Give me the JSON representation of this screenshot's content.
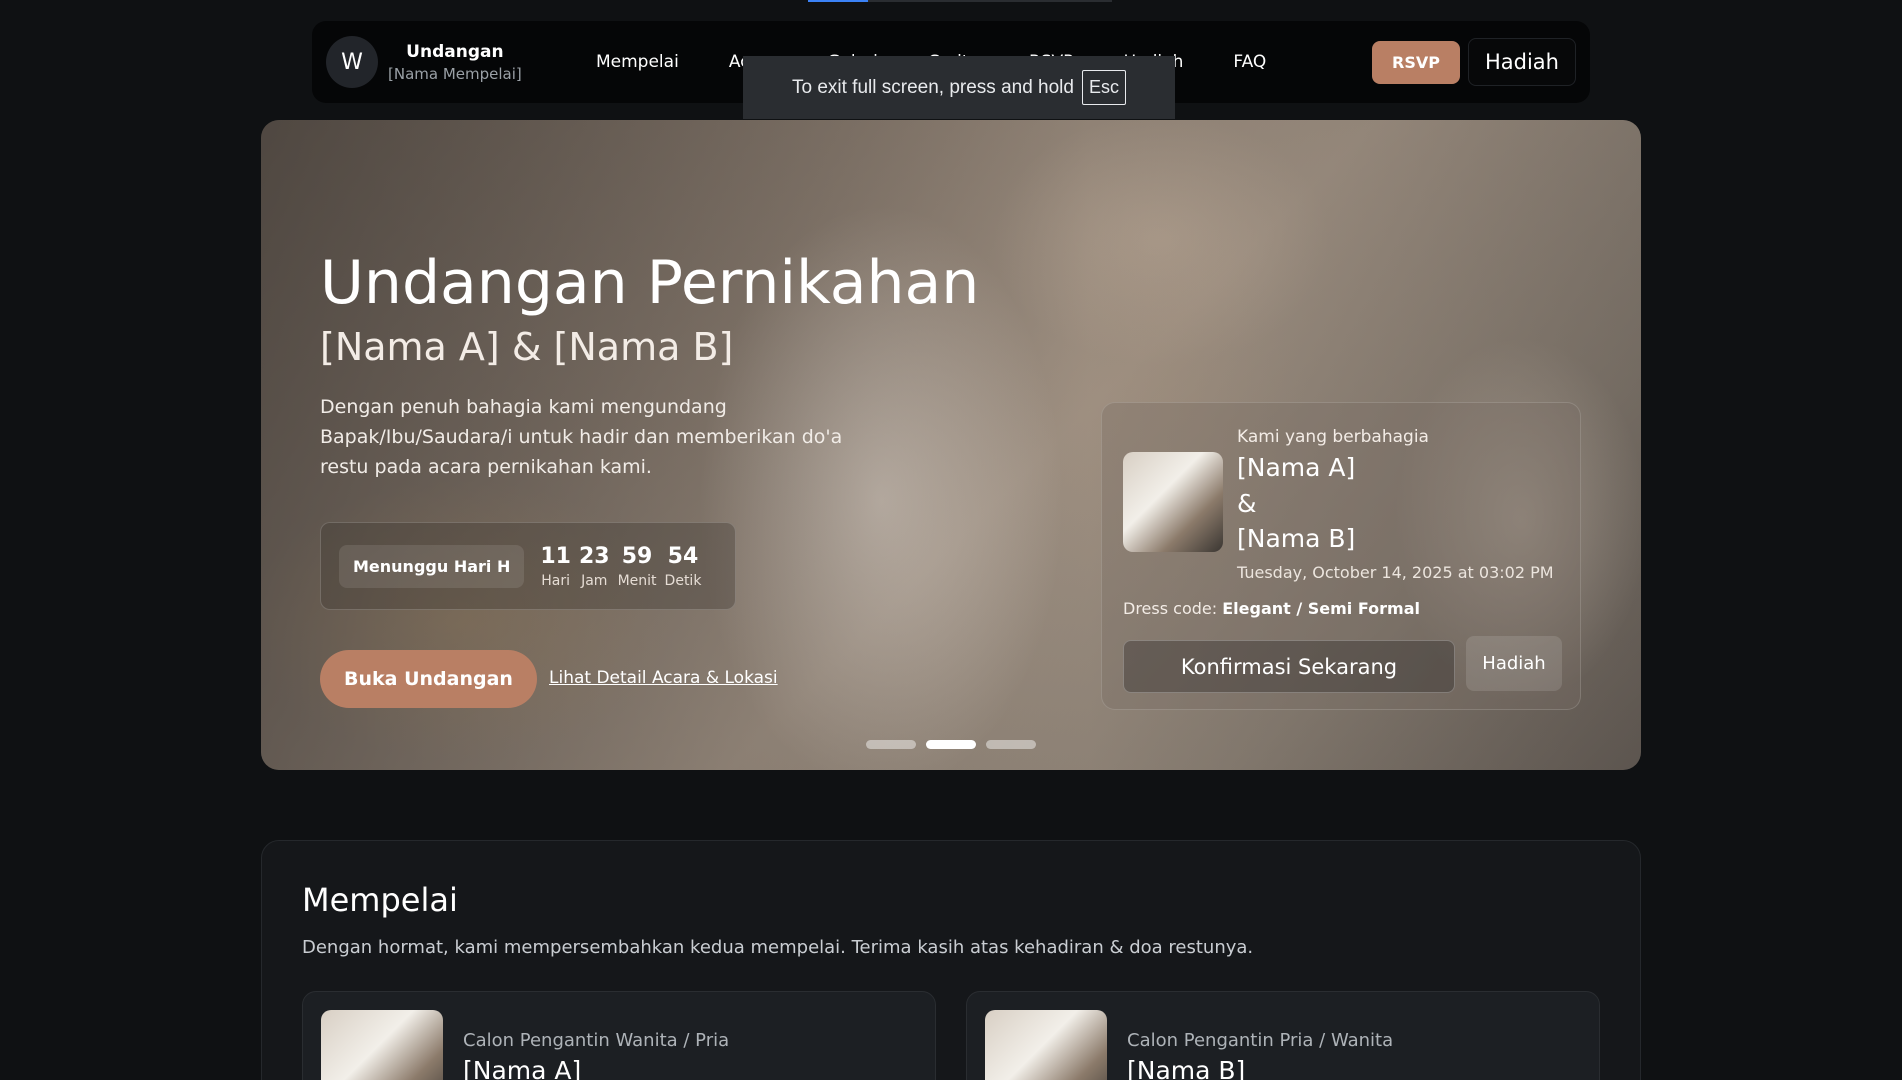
{
  "navbar": {
    "logo_letter": "W",
    "brand_title": "Undangan",
    "brand_subtitle": "[Nama Mempelai]",
    "links": [
      "Mempelai",
      "Acara",
      "Galeri",
      "Cerita",
      "RSVP",
      "Hadiah",
      "FAQ"
    ],
    "rsvp_label": "RSVP",
    "hadiah_label": "Hadiah"
  },
  "fullscreen_toast": {
    "message": "To exit full screen, press and hold",
    "key": "Esc"
  },
  "hero": {
    "title": "Undangan Pernikahan",
    "subtitle": "[Nama A] & [Nama B]",
    "description": "Dengan penuh bahagia kami mengundang Bapak/Ibu/Saudara/i untuk hadir dan memberikan do'a restu pada acara pernikahan kami.",
    "countdown": {
      "label": "Menunggu Hari H",
      "units": [
        {
          "value": "11",
          "label": "Hari"
        },
        {
          "value": "23",
          "label": "Jam"
        },
        {
          "value": "59",
          "label": "Menit"
        },
        {
          "value": "54",
          "label": "Detik"
        }
      ]
    },
    "open_button": "Buka Undangan",
    "detail_link": "Lihat Detail Acara & Lokasi",
    "slides_total": 3,
    "active_slide": 2
  },
  "info_card": {
    "lead": "Kami yang berbahagia",
    "name_a": "[Nama A]",
    "ampersand": "&",
    "name_b": "[Nama B]",
    "date": "Tuesday, October 14, 2025 at 03:02 PM",
    "dress_label": "Dress code:",
    "dress_value": "Elegant / Semi Formal",
    "confirm_button": "Konfirmasi Sekarang",
    "hadiah_button": "Hadiah"
  },
  "mempelai": {
    "title": "Mempelai",
    "description": "Dengan hormat, kami mempersembahkan kedua mempelai. Terima kasih atas kehadiran & doa restunya.",
    "cards": [
      {
        "role": "Calon Pengantin Wanita / Pria",
        "name": "[Nama A]"
      },
      {
        "role": "Calon Pengantin Pria / Wanita",
        "name": "[Nama B]"
      }
    ]
  },
  "colors": {
    "accent": "#b97f64",
    "background": "#0f1113",
    "navbar": "#050607"
  }
}
